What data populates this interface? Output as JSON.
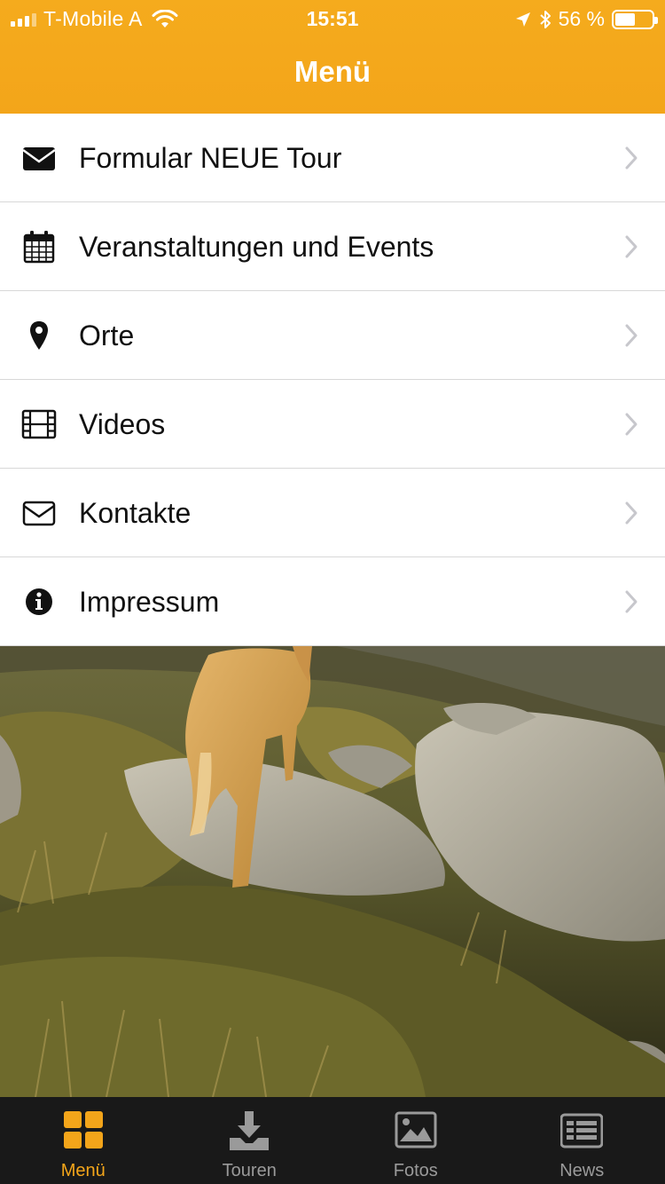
{
  "status_bar": {
    "carrier": "T-Mobile A",
    "time": "15:51",
    "battery": "56 %",
    "battery_level": 0.56,
    "icons": [
      "signal-icon",
      "wifi-icon",
      "location-arrow-icon",
      "bluetooth-icon",
      "battery-icon"
    ]
  },
  "nav": {
    "title": "Menü"
  },
  "colors": {
    "accent": "#f3a51a",
    "tab_bar_bg": "#191919",
    "tab_inactive": "#9a9a9a",
    "text": "#111111",
    "chevron": "#c7c7cc"
  },
  "menu": {
    "items": [
      {
        "label": "Formular NEUE Tour",
        "icon": "envelope-filled-icon"
      },
      {
        "label": "Veranstaltungen und Events",
        "icon": "calendar-icon"
      },
      {
        "label": "Orte",
        "icon": "map-marker-icon"
      },
      {
        "label": "Videos",
        "icon": "film-icon"
      },
      {
        "label": "Kontakte",
        "icon": "envelope-outline-icon"
      },
      {
        "label": "Impressum",
        "icon": "info-circle-icon"
      }
    ]
  },
  "photo": {
    "subject": "dog-on-rocks-image"
  },
  "tabs": [
    {
      "label": "Menü",
      "icon": "grid-icon",
      "active": true
    },
    {
      "label": "Touren",
      "icon": "download-icon",
      "active": false
    },
    {
      "label": "Fotos",
      "icon": "photo-icon",
      "active": false
    },
    {
      "label": "News",
      "icon": "news-icon",
      "active": false
    }
  ]
}
